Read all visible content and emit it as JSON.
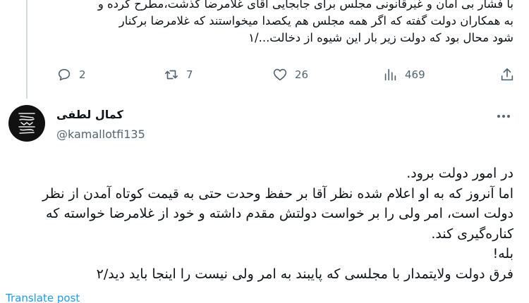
{
  "previous_tweet": {
    "lines": [
      "با فشار بی امان و غیرقانونی مجلس برای جابجایی آقای غلامرضا گذشت،مطرح کرده و",
      "به همکاران دولت گفته که اگر همه مجلس هم یکصدا میخواستند که غلامرضا برکنار",
      "شود محال بود که دولت زیر بار این شیوه از دخالت.../۱"
    ],
    "actions": {
      "reply_count": "2",
      "retweet_count": "7",
      "like_count": "26",
      "view_count": "469"
    }
  },
  "tweet": {
    "display_name": "کمال لطفی",
    "handle": "@kamallotfi135",
    "lines": [
      "در امور دولت برود.",
      "اما آنروز که به او اعلام شده نظر آقا بر حفظ وحدت حتی به قیمت کوتاه آمدن از نظر",
      "دولت است، امر ولی را بر خواست دولتش مقدم داشته و خود از غلامرضا خواسته که",
      "کناره‌گیری کند.",
      "بله!",
      "فرق دولت ولایتمدار با مجلسی که پایبند به امر ولی نیست را اینجا باید دید/۲"
    ],
    "translate_label": "Translate post"
  }
}
